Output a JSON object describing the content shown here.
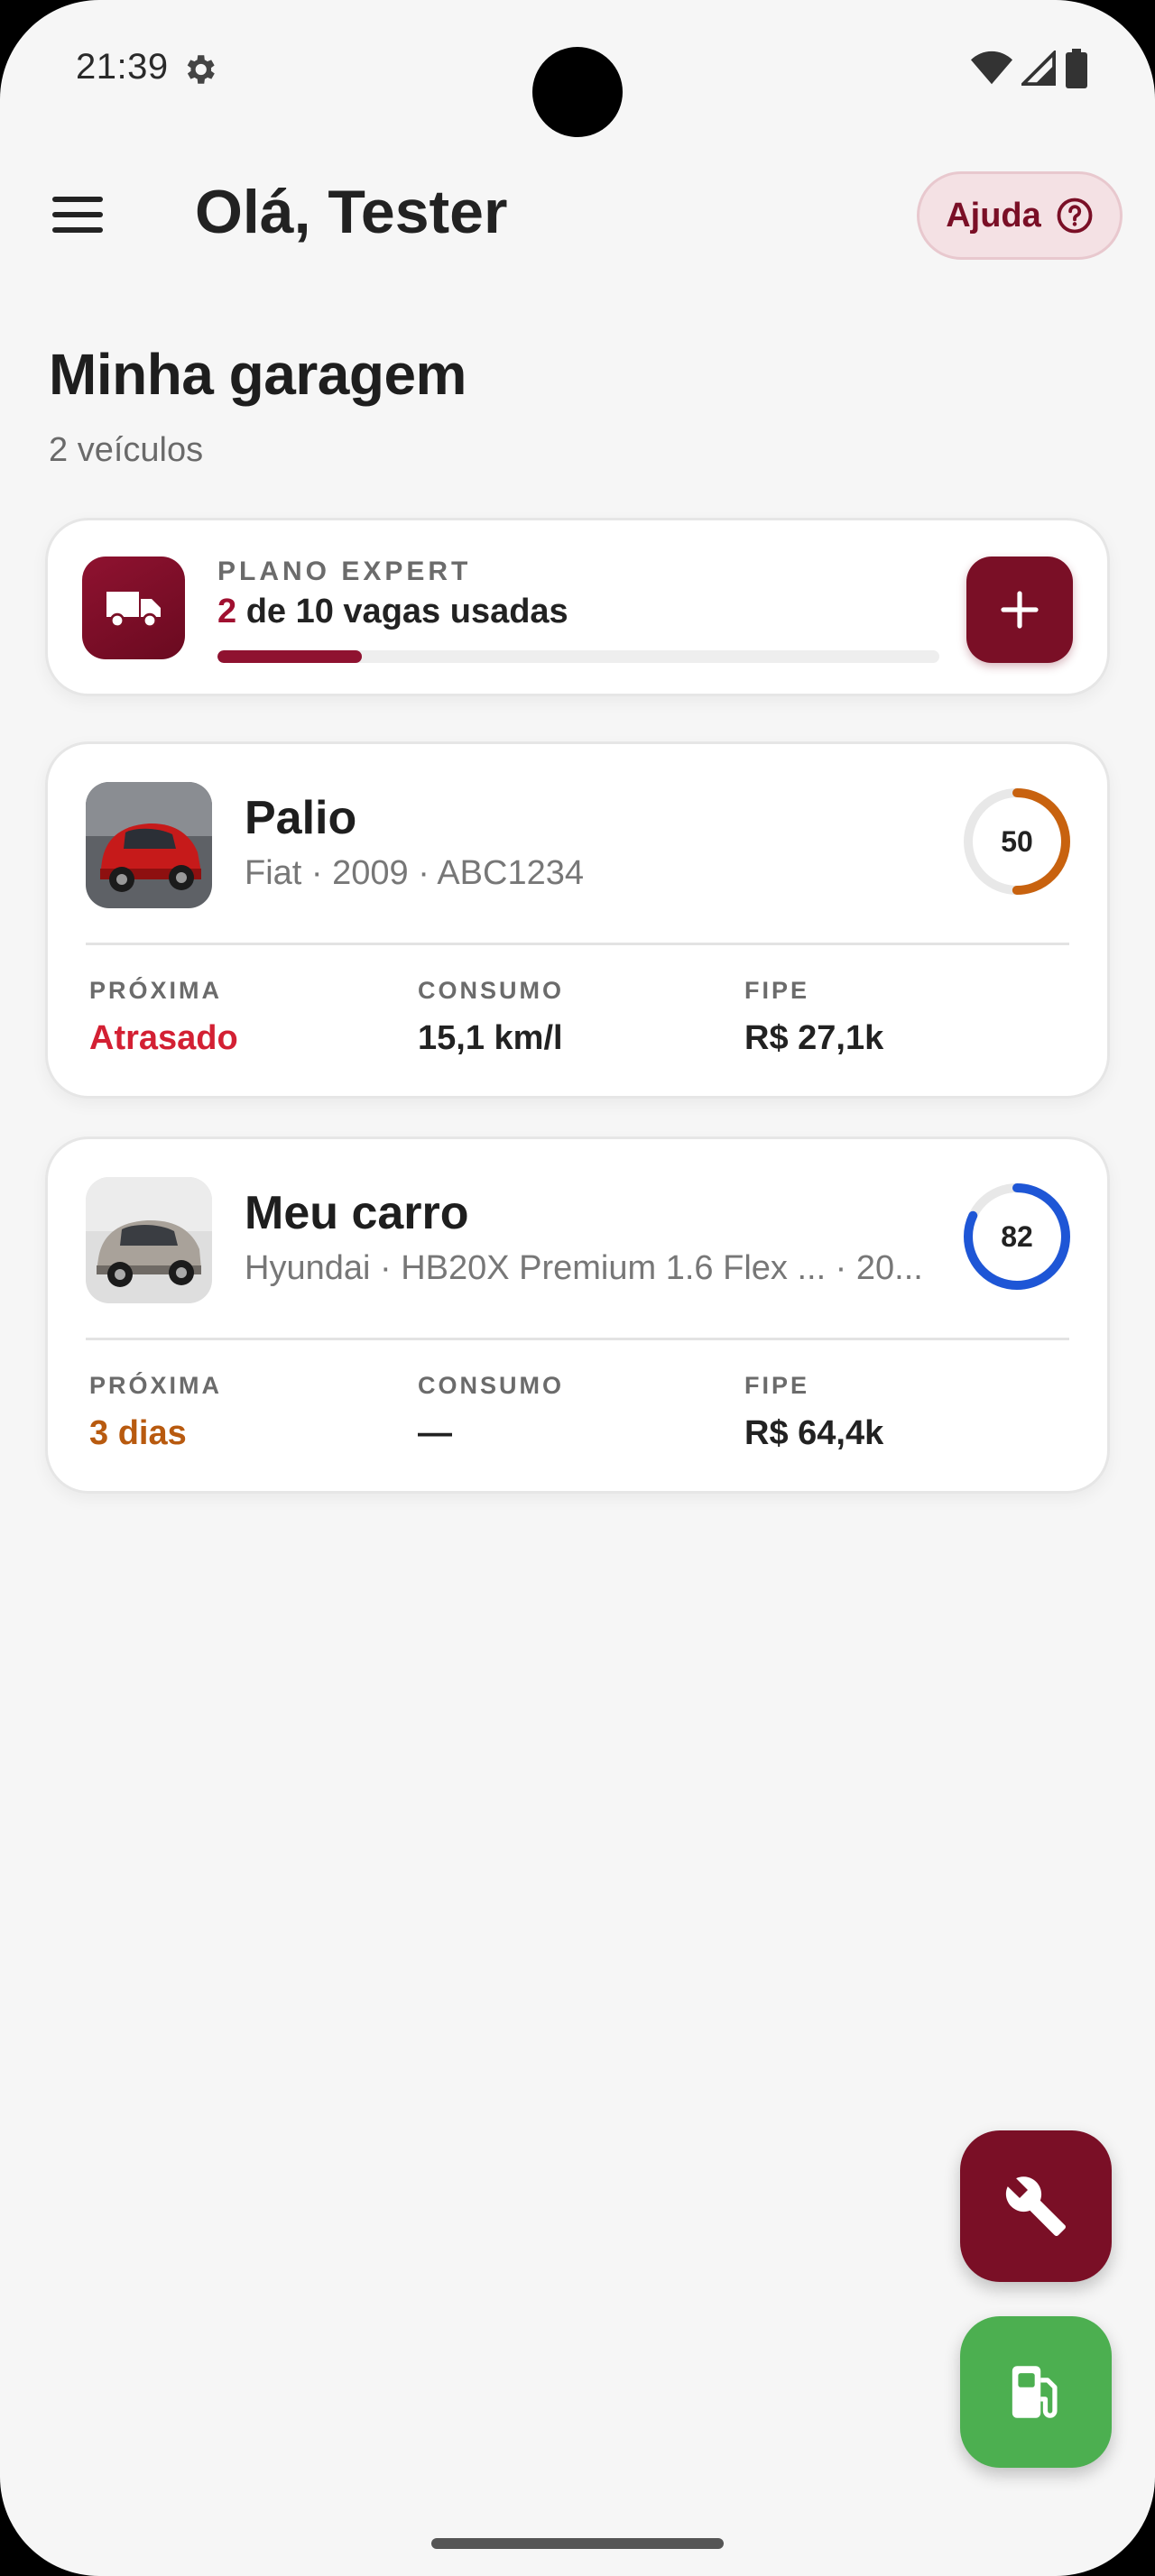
{
  "status_bar": {
    "time": "21:39"
  },
  "header": {
    "greeting": "Olá, Tester",
    "help_label": "Ajuda"
  },
  "page": {
    "title": "Minha garagem",
    "subtitle": "2 veículos"
  },
  "plan": {
    "label": "PLANO EXPERT",
    "used": "2",
    "usage_rest": " de 10 vagas usadas",
    "used_fraction": 0.2
  },
  "vehicles": [
    {
      "name": "Palio",
      "info": "Fiat · 2009 · ABC1234",
      "score": "50",
      "score_value": 50,
      "score_color": "#c8620f",
      "stats": [
        {
          "label": "PRÓXIMA",
          "value": "Atrasado"
        },
        {
          "label": "CONSUMO",
          "value": "15,1 km/l"
        },
        {
          "label": "FIPE",
          "value": "R$ 27,1k"
        }
      ]
    },
    {
      "name": "Meu carro",
      "info": "Hyundai · HB20X Premium 1.6 Flex ... · 20...",
      "score": "82",
      "score_value": 82,
      "score_color": "#1e56d6",
      "stats": [
        {
          "label": "PRÓXIMA",
          "value": "3 dias"
        },
        {
          "label": "CONSUMO",
          "value": "—"
        },
        {
          "label": "FIPE",
          "value": "R$ 64,4k"
        }
      ]
    }
  ],
  "colors": {
    "brand": "#7a0f26",
    "fuel": "#4caf50",
    "overdue": "#d32033",
    "soon": "#b85a0f"
  },
  "icons": [
    "menu-icon",
    "help-icon",
    "truck-icon",
    "plus-icon",
    "wrench-icon",
    "fuel-pump-icon"
  ]
}
